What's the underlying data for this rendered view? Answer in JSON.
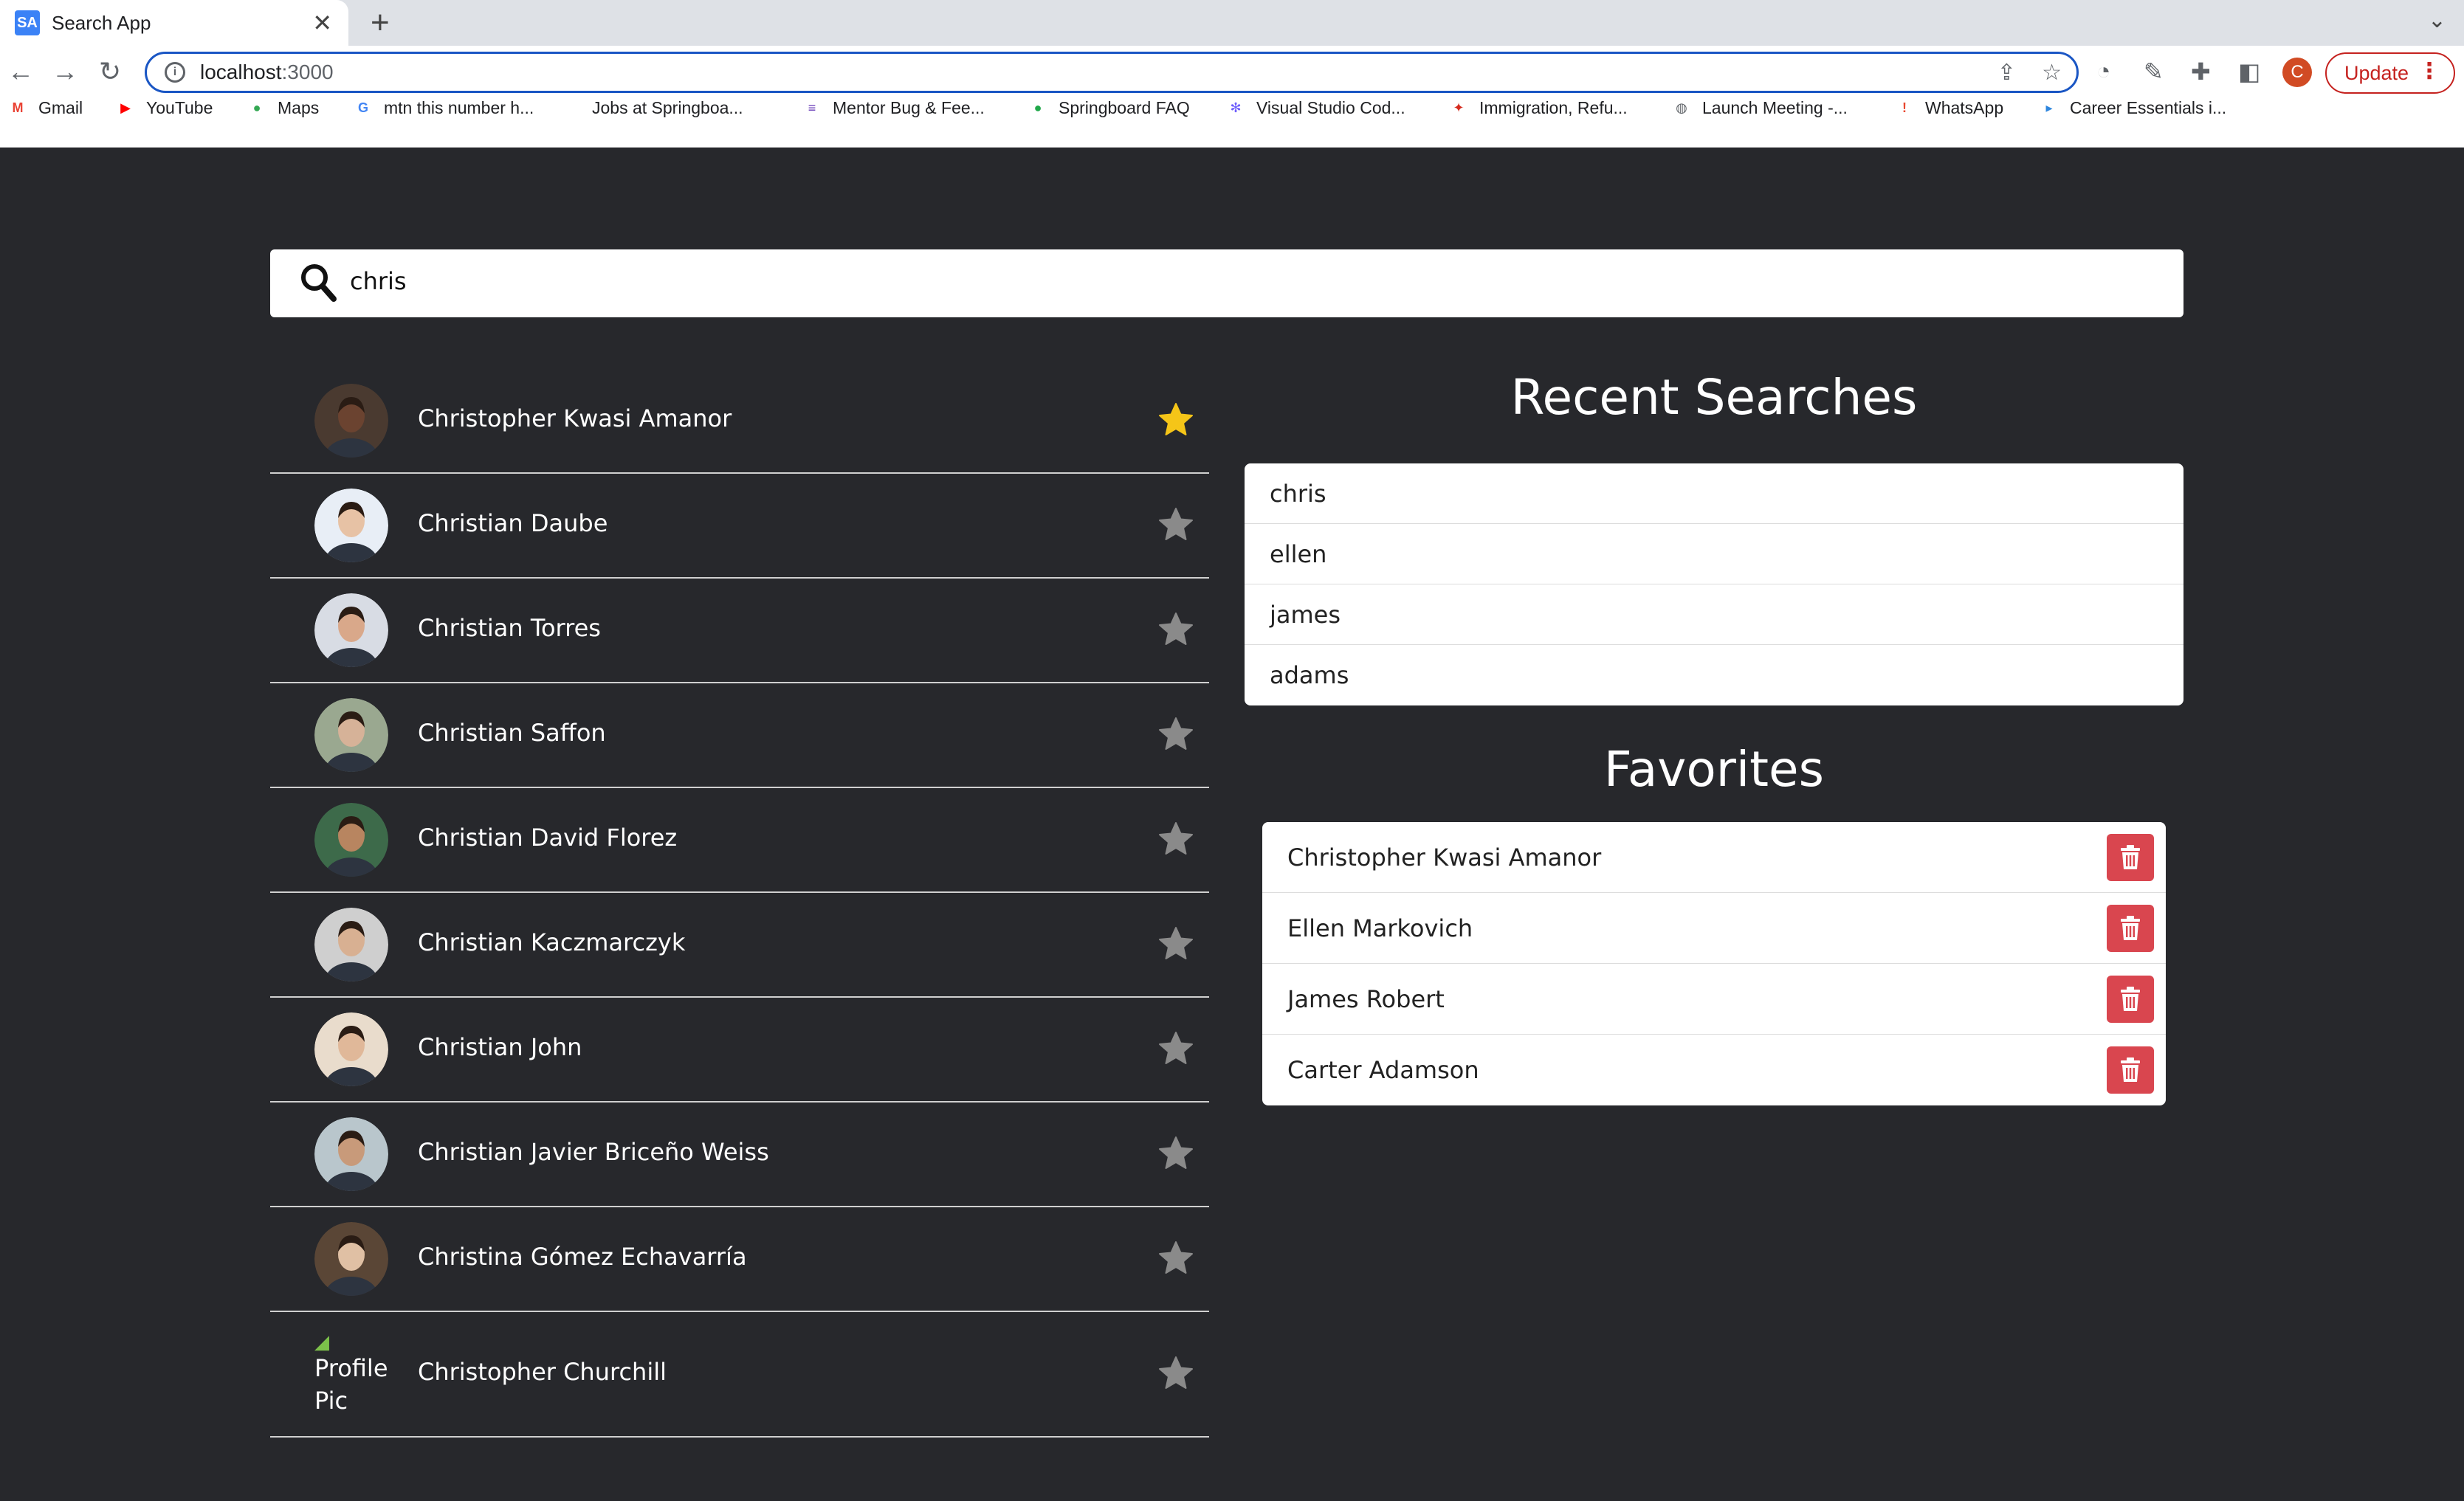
{
  "browser": {
    "tab_title": "Search App",
    "tab_favicon": "SA",
    "url_host": "localhost",
    "url_port": ":3000",
    "profile_initial": "C",
    "update_label": "Update",
    "bookmarks": [
      {
        "label": "Gmail",
        "icon": "gmail-icon",
        "color": "#ea4335",
        "glyph": "M"
      },
      {
        "label": "YouTube",
        "icon": "youtube-icon",
        "color": "#ff0000",
        "glyph": "▶"
      },
      {
        "label": "Maps",
        "icon": "maps-icon",
        "color": "#34a853",
        "glyph": "●"
      },
      {
        "label": "mtn this number h...",
        "icon": "google-icon",
        "color": "#4285f4",
        "glyph": "G"
      },
      {
        "label": "Jobs at Springboa...",
        "icon": "blank-page-icon",
        "color": "#ffffff",
        "glyph": ""
      },
      {
        "label": "Mentor Bug & Fee...",
        "icon": "forms-icon",
        "color": "#673ab7",
        "glyph": "≡"
      },
      {
        "label": "Springboard FAQ",
        "icon": "springboard-icon",
        "color": "#20a84a",
        "glyph": "●"
      },
      {
        "label": "Visual Studio Cod...",
        "icon": "gear-flower-icon",
        "color": "#6d5dfc",
        "glyph": "✻"
      },
      {
        "label": "Immigration, Refu...",
        "icon": "maple-leaf-icon",
        "color": "#d52b1e",
        "glyph": "✦"
      },
      {
        "label": "Launch Meeting -...",
        "icon": "globe-icon",
        "color": "#5f6368",
        "glyph": "◍"
      },
      {
        "label": "WhatsApp",
        "icon": "whatsapp-icon",
        "color": "#e8472f",
        "glyph": "!"
      },
      {
        "label": "Career Essentials i...",
        "icon": "video-icon",
        "color": "#2e86de",
        "glyph": "▸"
      }
    ]
  },
  "search": {
    "query": "chris"
  },
  "results": [
    {
      "name": "Christopher Kwasi Amanor",
      "favorite": true,
      "avatar_bg": "#4a3a30",
      "skin": "#6b4330"
    },
    {
      "name": "Christian Daube",
      "favorite": false,
      "avatar_bg": "#e8eef6",
      "skin": "#e7c2a5"
    },
    {
      "name": "Christian Torres",
      "favorite": false,
      "avatar_bg": "#d8dce4",
      "skin": "#d9a88a"
    },
    {
      "name": "Christian Saffon",
      "favorite": false,
      "avatar_bg": "#9aa890",
      "skin": "#d6b298"
    },
    {
      "name": "Christian David Florez",
      "favorite": false,
      "avatar_bg": "#3d6a4a",
      "skin": "#b88560"
    },
    {
      "name": "Christian Kaczmarczyk",
      "favorite": false,
      "avatar_bg": "#cfcfcf",
      "skin": "#d8b092"
    },
    {
      "name": "Christian John",
      "favorite": false,
      "avatar_bg": "#e9dccc",
      "skin": "#e0b899"
    },
    {
      "name": "Christian Javier Briceño Weiss",
      "favorite": false,
      "avatar_bg": "#b9c6cc",
      "skin": "#c89a7a"
    },
    {
      "name": "Christina Gómez Echavarría",
      "favorite": false,
      "avatar_bg": "#5a4636",
      "skin": "#e0c0a4"
    },
    {
      "name": "Christopher Churchill",
      "favorite": false,
      "broken_image_alt": "Profile Pic"
    }
  ],
  "recent": {
    "title": "Recent Searches",
    "items": [
      "chris",
      "ellen",
      "james",
      "adams"
    ]
  },
  "favorites": {
    "title": "Favorites",
    "items": [
      "Christopher Kwasi Amanor",
      "Ellen Markovich",
      "James Robert",
      "Carter Adamson"
    ]
  },
  "colors": {
    "page_bg": "#27282c",
    "star_active": "#f5c518",
    "star_inactive": "#8a8a8a",
    "delete_button": "#d9464f"
  }
}
